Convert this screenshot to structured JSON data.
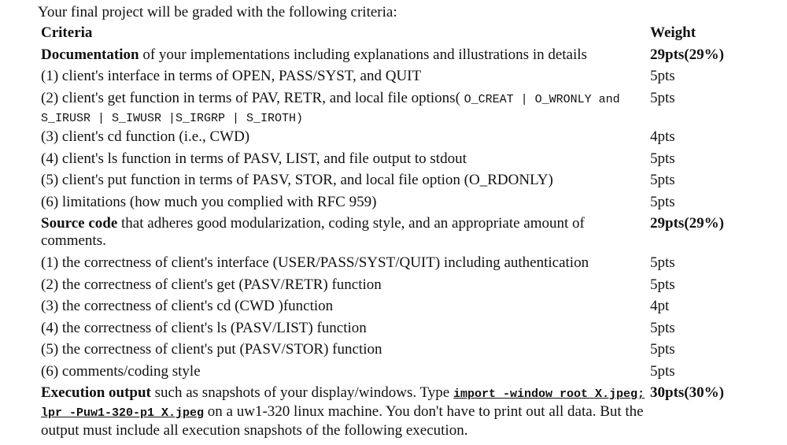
{
  "intro": "Your final project will be graded with the following criteria:",
  "header": {
    "criteria": "Criteria",
    "weight": "Weight"
  },
  "doc": {
    "title": "Documentation",
    "title_rest": " of your implementations including explanations and illustrations in details",
    "weight": "29pts(29%)",
    "items": [
      {
        "text": "(1) client's interface in terms of OPEN, PASS/SYST, and QUIT",
        "weight": "5pts"
      },
      {
        "text_a": "(2) client's get function in terms of PAV, RETR, and local file options( ",
        "code": "O_CREAT | O_WRONLY and S_IRUSR | S_IWUSR |S_IRGRP | S_IROTH)",
        "weight": "5pts"
      },
      {
        "text": "(3) client's cd function (i.e., CWD)",
        "weight": "4pts"
      },
      {
        "text": "(4) client's ls function in terms of PASV, LIST, and file output to stdout",
        "weight": "5pts"
      },
      {
        "text": "(5) client's put function in terms of PASV, STOR, and local file option (O_RDONLY)",
        "weight": "5pts"
      },
      {
        "text": "(6) limitations (how much you complied with RFC 959)",
        "weight": "5pts"
      }
    ]
  },
  "src": {
    "title": "Source code",
    "title_rest": " that adheres good modularization, coding style, and an appropriate amount of comments.",
    "weight": "29pts(29%)",
    "items": [
      {
        "text": "(1) the correctness of client's interface (USER/PASS/SYST/QUIT) including authentication",
        "weight": "5pts"
      },
      {
        "text": "(2) the correctness of client's get (PASV/RETR) function",
        "weight": "5pts"
      },
      {
        "text": "(3) the correctness of client's cd (CWD )function",
        "weight": "4pt"
      },
      {
        "text": "(4) the correctness of client's ls (PASV/LIST) function",
        "weight": "5pts"
      },
      {
        "text": "(5) the correctness of client's put (PASV/STOR) function",
        "weight": "5pts"
      },
      {
        "text": "(6) comments/coding style",
        "weight": "5pts"
      }
    ]
  },
  "exec": {
    "title": "Execution output",
    "text_a": " such as snapshots of your display/windows. Type ",
    "cmd": "import -window root X.jpeg; lpr -Puw1-320-p1 X.jpeg",
    "text_b": " on a uw1-320 linux machine. You don't have to print out all data. But the output must include all execution snapshots of the following execution.",
    "weight": "30pts(30%)"
  }
}
